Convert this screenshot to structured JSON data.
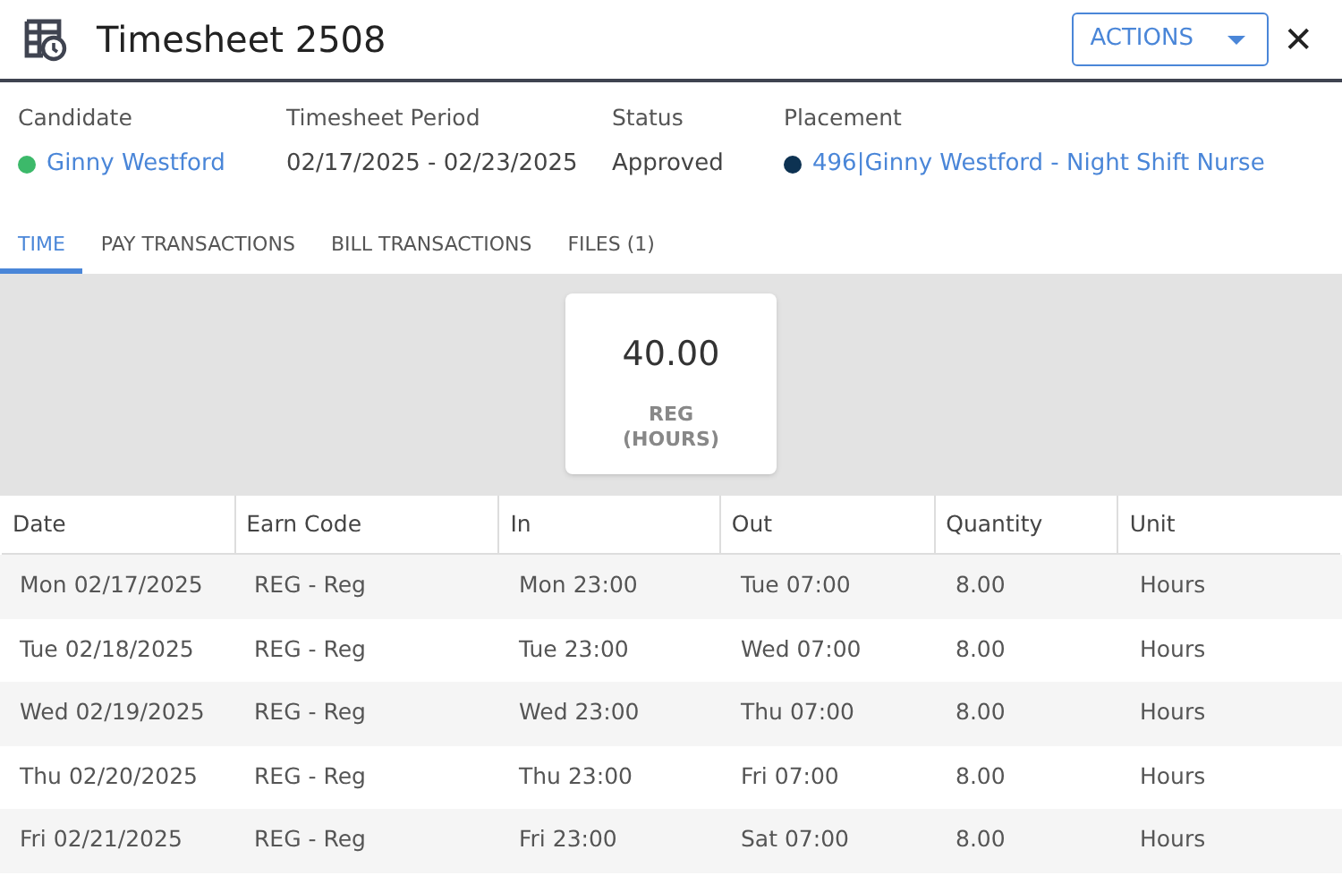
{
  "header": {
    "title": "Timesheet 2508",
    "actions_label": "ACTIONS",
    "close": "✕"
  },
  "fields": [
    {
      "label": "Candidate",
      "value": "Ginny Westford",
      "kind": "link",
      "color": "#3cb96a"
    },
    {
      "label": "Timesheet Period",
      "value": "02/17/2025 - 02/23/2025",
      "kind": "text"
    },
    {
      "label": "Status",
      "value": "Approved",
      "kind": "text"
    },
    {
      "label": "Placement",
      "value": "496|Ginny Westford - Night Shift Nurse",
      "kind": "link",
      "color": "#0d3252"
    }
  ],
  "tabs": [
    {
      "label": "TIME",
      "selected": true
    },
    {
      "label": "PAY TRANSACTIONS",
      "selected": false
    },
    {
      "label": "BILL TRANSACTIONS",
      "selected": false
    },
    {
      "label": "FILES (1)",
      "selected": false
    }
  ],
  "summary_card": {
    "value": "40.00",
    "label": "REG\n(HOURS)"
  },
  "table": {
    "columns": [
      "Date",
      "Earn Code",
      "In",
      "Out",
      "Quantity",
      "Unit"
    ],
    "rows": [
      [
        "Mon 02/17/2025",
        "REG - Reg",
        "Mon 23:00",
        "Tue 07:00",
        "8.00",
        "Hours"
      ],
      [
        "Tue 02/18/2025",
        "REG - Reg",
        "Tue 23:00",
        "Wed 07:00",
        "8.00",
        "Hours"
      ],
      [
        "Wed 02/19/2025",
        "REG - Reg",
        "Wed 23:00",
        "Thu 07:00",
        "8.00",
        "Hours"
      ],
      [
        "Thu 02/20/2025",
        "REG - Reg",
        "Thu 23:00",
        "Fri 07:00",
        "8.00",
        "Hours"
      ],
      [
        "Fri 02/21/2025",
        "REG - Reg",
        "Fri 23:00",
        "Sat 07:00",
        "8.00",
        "Hours"
      ]
    ]
  }
}
